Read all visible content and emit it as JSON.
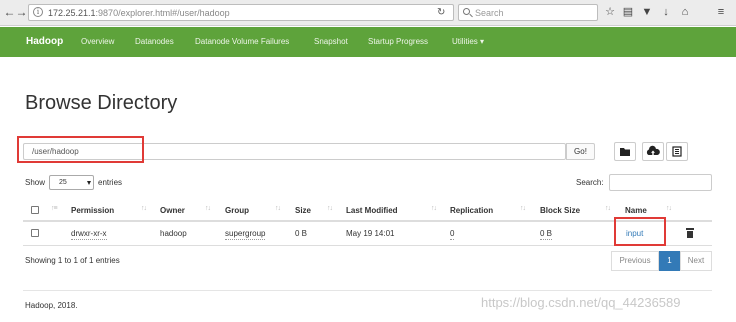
{
  "browser": {
    "url_host": "172.25.21.1",
    "url_rest": ":9870/explorer.html#/user/hadoop",
    "search_placeholder": "Search"
  },
  "navbar": {
    "brand": "Hadoop",
    "items": [
      "Overview",
      "Datanodes",
      "Datanode Volume Failures",
      "Snapshot",
      "Startup Progress",
      "Utilities ▾"
    ]
  },
  "page": {
    "title": "Browse Directory",
    "path_value": "/user/hadoop",
    "go_label": "Go!"
  },
  "controls": {
    "show_label": "Show",
    "page_size": "25",
    "entries_label": "entries",
    "search_label": "Search:"
  },
  "table": {
    "columns": [
      "Permission",
      "Owner",
      "Group",
      "Size",
      "Last Modified",
      "Replication",
      "Block Size",
      "Name"
    ],
    "rows": [
      {
        "permission": "drwxr-xr-x",
        "owner": "hadoop",
        "group": "supergroup",
        "size": "0 B",
        "last_modified": "May 19 14:01",
        "replication": "0",
        "block_size": "0 B",
        "name": "input"
      }
    ]
  },
  "pagination": {
    "info": "Showing 1 to 1 of 1 entries",
    "previous": "Previous",
    "current": "1",
    "next": "Next"
  },
  "footer": {
    "text": "Hadoop, 2018."
  },
  "watermark": "https://blog.csdn.net/qq_44236589",
  "colors": {
    "navbar": "#5ea33b",
    "highlight": "#e03a36",
    "link": "#337ab7"
  }
}
